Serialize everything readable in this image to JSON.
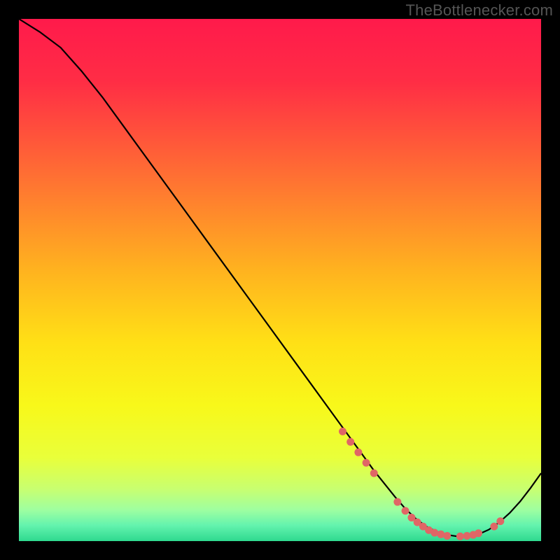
{
  "attribution": "TheBottlenecker.com",
  "chart_data": {
    "type": "line",
    "title": "",
    "xlabel": "",
    "ylabel": "",
    "xlim": [
      0,
      100
    ],
    "ylim": [
      0,
      100
    ],
    "gradient_stops": [
      {
        "offset": 0.0,
        "color": "#ff1a4b"
      },
      {
        "offset": 0.12,
        "color": "#ff2d45"
      },
      {
        "offset": 0.3,
        "color": "#ff6f33"
      },
      {
        "offset": 0.48,
        "color": "#ffb21f"
      },
      {
        "offset": 0.62,
        "color": "#ffe016"
      },
      {
        "offset": 0.74,
        "color": "#f8f81a"
      },
      {
        "offset": 0.84,
        "color": "#e9ff3a"
      },
      {
        "offset": 0.9,
        "color": "#c8ff70"
      },
      {
        "offset": 0.94,
        "color": "#9fffa0"
      },
      {
        "offset": 0.97,
        "color": "#63f3ae"
      },
      {
        "offset": 1.0,
        "color": "#2fd98f"
      }
    ],
    "series": [
      {
        "name": "bottleneck-curve",
        "color": "#000000",
        "x": [
          0,
          4,
          8,
          12,
          16,
          20,
          24,
          28,
          32,
          36,
          40,
          44,
          48,
          52,
          56,
          60,
          64,
          68,
          70,
          72,
          74,
          76,
          78,
          80,
          82,
          84,
          86,
          88,
          90,
          92,
          94,
          96,
          98,
          100
        ],
        "y": [
          100,
          97.5,
          94.5,
          90,
          85,
          79.5,
          74,
          68.5,
          63,
          57.5,
          52,
          46.5,
          41,
          35.5,
          30,
          24.5,
          19,
          13.5,
          11,
          8.5,
          6.2,
          4.3,
          2.8,
          1.8,
          1.2,
          0.9,
          0.9,
          1.3,
          2.2,
          3.6,
          5.4,
          7.6,
          10.2,
          13
        ]
      }
    ],
    "markers": {
      "name": "highlight-points",
      "color": "#e06666",
      "radius": 5.5,
      "points": [
        {
          "x": 62,
          "y": 21
        },
        {
          "x": 63.5,
          "y": 19
        },
        {
          "x": 65,
          "y": 17
        },
        {
          "x": 66.5,
          "y": 15
        },
        {
          "x": 68,
          "y": 13
        },
        {
          "x": 72.5,
          "y": 7.5
        },
        {
          "x": 74,
          "y": 5.8
        },
        {
          "x": 75.2,
          "y": 4.5
        },
        {
          "x": 76.3,
          "y": 3.6
        },
        {
          "x": 77.4,
          "y": 2.8
        },
        {
          "x": 78.5,
          "y": 2.1
        },
        {
          "x": 79.6,
          "y": 1.6
        },
        {
          "x": 80.8,
          "y": 1.3
        },
        {
          "x": 82,
          "y": 1.0
        },
        {
          "x": 84.5,
          "y": 0.9
        },
        {
          "x": 85.8,
          "y": 1.0
        },
        {
          "x": 87,
          "y": 1.2
        },
        {
          "x": 88,
          "y": 1.5
        },
        {
          "x": 91,
          "y": 2.8
        },
        {
          "x": 92.2,
          "y": 3.8
        }
      ]
    }
  }
}
